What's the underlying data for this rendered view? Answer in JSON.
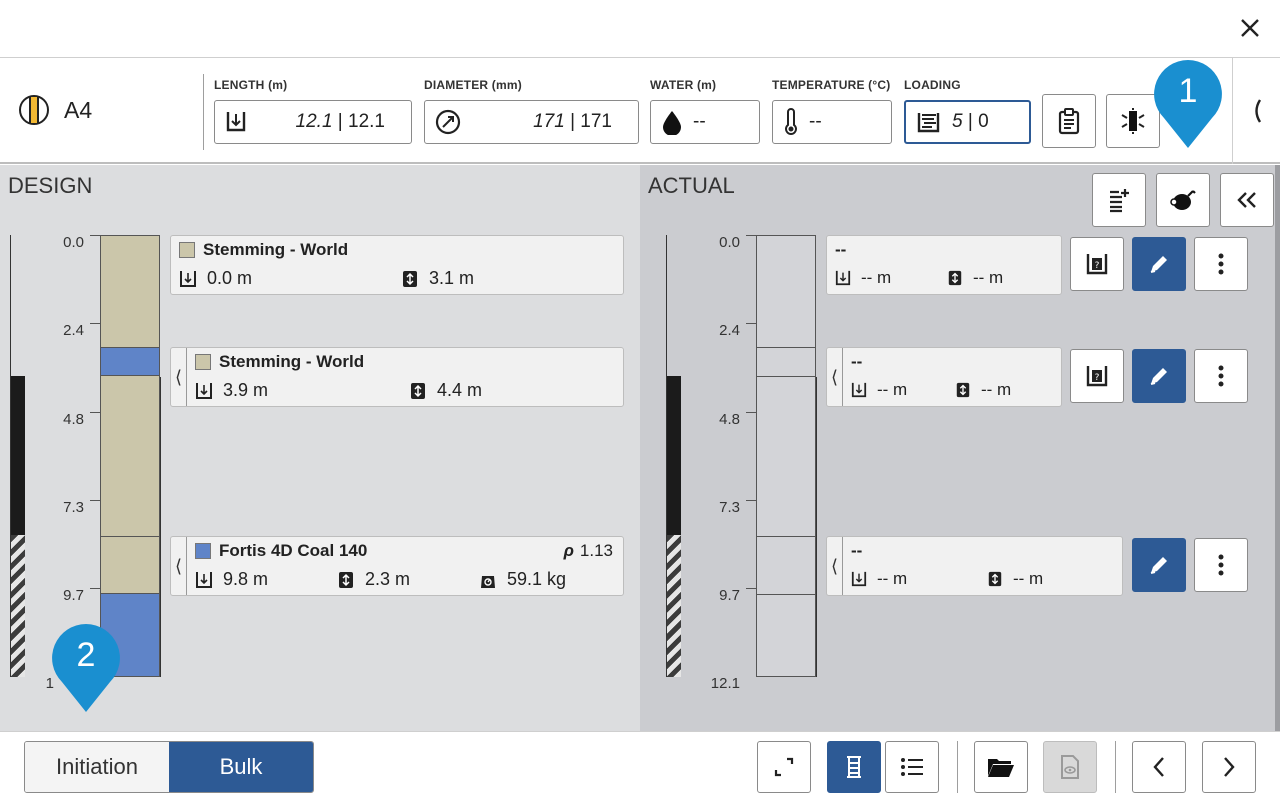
{
  "hole": {
    "id": "A4"
  },
  "fields": {
    "length": {
      "label": "LENGTH (m)",
      "design": "12.1",
      "actual": " | 12.1"
    },
    "diameter": {
      "label": "DIAMETER (mm)",
      "design": "171",
      "actual": " | 171"
    },
    "water": {
      "label": "WATER (m)",
      "value": "--"
    },
    "temperature": {
      "label": "TEMPERATURE (°C)",
      "value": "--"
    },
    "loading": {
      "label": "LOADING",
      "design": "5",
      "actual": " | 0"
    }
  },
  "design": {
    "title": "DESIGN",
    "depths": [
      "0.0",
      "2.4",
      "4.8",
      "7.3",
      "9.7",
      "1"
    ],
    "decks": [
      {
        "name": "Stemming - World",
        "from": "0.0 m",
        "length": "3.1 m",
        "color": "#cbc6aa"
      },
      {
        "name": "Stemming - World",
        "from": "3.9 m",
        "length": "4.4 m",
        "color": "#cbc6aa"
      },
      {
        "name": "Fortis 4D Coal 140",
        "density_symbol": "ρ",
        "density": "1.13",
        "from": "9.8 m",
        "length": "2.3 m",
        "mass": "59.1 kg",
        "color": "#5f84c8"
      }
    ]
  },
  "actual": {
    "title": "ACTUAL",
    "depths": [
      "0.0",
      "2.4",
      "4.8",
      "7.3",
      "9.7",
      "12.1"
    ],
    "decks": [
      {
        "name": "--",
        "from": "-- m",
        "length": "-- m"
      },
      {
        "name": "--",
        "from": "-- m",
        "length": "-- m"
      },
      {
        "name": "--",
        "from": "-- m",
        "length": "-- m"
      }
    ]
  },
  "footer": {
    "segments": [
      "Initiation",
      "Bulk"
    ],
    "active_segment": "Bulk"
  },
  "callouts": [
    "1",
    "2"
  ],
  "colors": {
    "accent": "#2d5a95",
    "callout": "#1a8fd0",
    "stemming": "#cbc6aa",
    "explosive": "#5f84c8"
  }
}
